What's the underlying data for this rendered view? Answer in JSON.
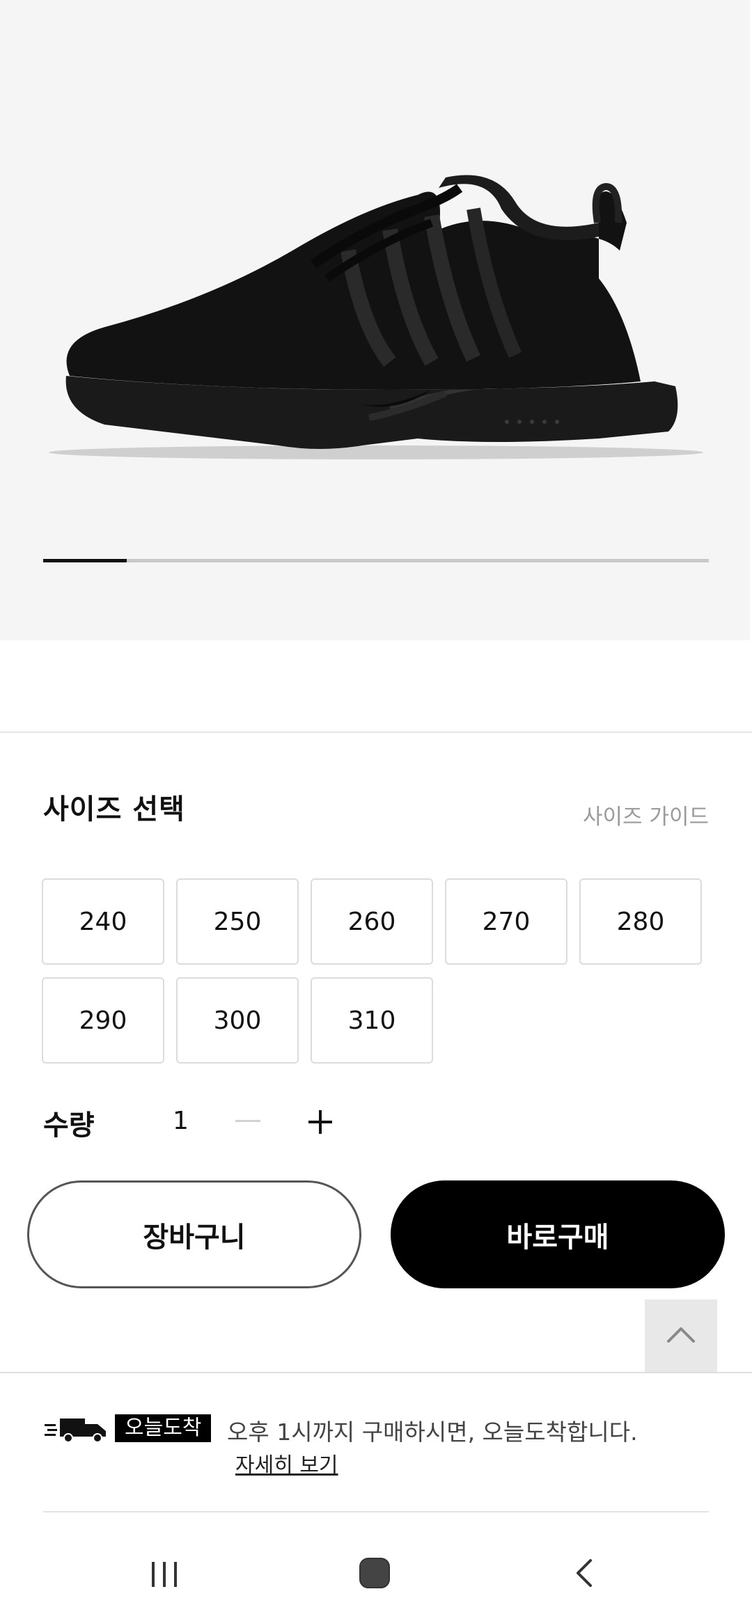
{
  "product": {
    "image_icon": "black-sneaker-image",
    "carousel_progress": 0.125
  },
  "size_section": {
    "title": "사이즈 선택",
    "guide_link": "사이즈 가이드",
    "sizes": [
      "240",
      "250",
      "260",
      "270",
      "280",
      "290",
      "300",
      "310"
    ]
  },
  "quantity": {
    "label": "수량",
    "value": "1",
    "minus_icon": "minus-icon",
    "plus_icon": "plus-icon"
  },
  "actions": {
    "cart_label": "장바구니",
    "buy_label": "바로구매",
    "scroll_top_icon": "chevron-up-icon"
  },
  "delivery": {
    "truck_icon": "delivery-truck-icon",
    "badge": "오늘도착",
    "message": "오후 1시까지 구매하시면, 오늘도착합니다.",
    "detail_link": "자세히 보기"
  },
  "system_nav": {
    "recents_icon": "recent-apps-icon",
    "home_icon": "home-icon",
    "back_icon": "back-icon"
  },
  "colors": {
    "primary": "#000000",
    "hero_bg": "#f5f5f5",
    "border": "#dcdcdc",
    "muted_text": "#9a9a9a"
  }
}
